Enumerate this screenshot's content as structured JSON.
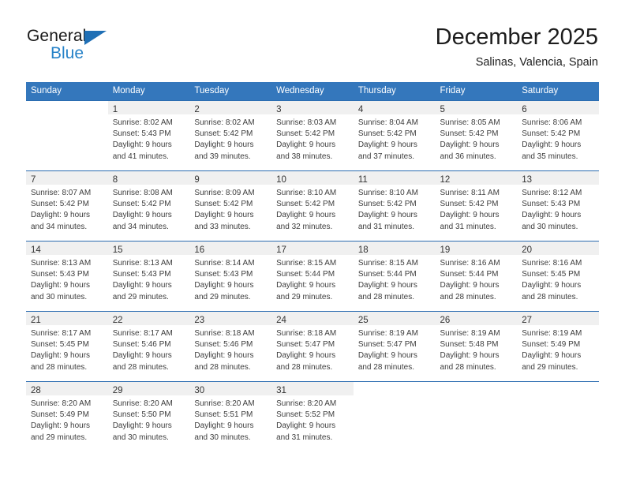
{
  "brand": {
    "name_part1": "General",
    "name_part2": "Blue",
    "accent_color": "#2682c8",
    "triangle_color": "#1f6fb5"
  },
  "header": {
    "title": "December 2025",
    "subtitle": "Salinas, Valencia, Spain"
  },
  "calendar": {
    "header_bg": "#3477bc",
    "separator_color": "#2b6cb0",
    "daynum_band_bg": "#f0f0f0",
    "weekdays": [
      "Sunday",
      "Monday",
      "Tuesday",
      "Wednesday",
      "Thursday",
      "Friday",
      "Saturday"
    ],
    "weeks": [
      [
        {
          "day": "",
          "sunrise": "",
          "sunset": "",
          "daylight1": "",
          "daylight2": ""
        },
        {
          "day": "1",
          "sunrise": "Sunrise: 8:02 AM",
          "sunset": "Sunset: 5:43 PM",
          "daylight1": "Daylight: 9 hours",
          "daylight2": "and 41 minutes."
        },
        {
          "day": "2",
          "sunrise": "Sunrise: 8:02 AM",
          "sunset": "Sunset: 5:42 PM",
          "daylight1": "Daylight: 9 hours",
          "daylight2": "and 39 minutes."
        },
        {
          "day": "3",
          "sunrise": "Sunrise: 8:03 AM",
          "sunset": "Sunset: 5:42 PM",
          "daylight1": "Daylight: 9 hours",
          "daylight2": "and 38 minutes."
        },
        {
          "day": "4",
          "sunrise": "Sunrise: 8:04 AM",
          "sunset": "Sunset: 5:42 PM",
          "daylight1": "Daylight: 9 hours",
          "daylight2": "and 37 minutes."
        },
        {
          "day": "5",
          "sunrise": "Sunrise: 8:05 AM",
          "sunset": "Sunset: 5:42 PM",
          "daylight1": "Daylight: 9 hours",
          "daylight2": "and 36 minutes."
        },
        {
          "day": "6",
          "sunrise": "Sunrise: 8:06 AM",
          "sunset": "Sunset: 5:42 PM",
          "daylight1": "Daylight: 9 hours",
          "daylight2": "and 35 minutes."
        }
      ],
      [
        {
          "day": "7",
          "sunrise": "Sunrise: 8:07 AM",
          "sunset": "Sunset: 5:42 PM",
          "daylight1": "Daylight: 9 hours",
          "daylight2": "and 34 minutes."
        },
        {
          "day": "8",
          "sunrise": "Sunrise: 8:08 AM",
          "sunset": "Sunset: 5:42 PM",
          "daylight1": "Daylight: 9 hours",
          "daylight2": "and 34 minutes."
        },
        {
          "day": "9",
          "sunrise": "Sunrise: 8:09 AM",
          "sunset": "Sunset: 5:42 PM",
          "daylight1": "Daylight: 9 hours",
          "daylight2": "and 33 minutes."
        },
        {
          "day": "10",
          "sunrise": "Sunrise: 8:10 AM",
          "sunset": "Sunset: 5:42 PM",
          "daylight1": "Daylight: 9 hours",
          "daylight2": "and 32 minutes."
        },
        {
          "day": "11",
          "sunrise": "Sunrise: 8:10 AM",
          "sunset": "Sunset: 5:42 PM",
          "daylight1": "Daylight: 9 hours",
          "daylight2": "and 31 minutes."
        },
        {
          "day": "12",
          "sunrise": "Sunrise: 8:11 AM",
          "sunset": "Sunset: 5:42 PM",
          "daylight1": "Daylight: 9 hours",
          "daylight2": "and 31 minutes."
        },
        {
          "day": "13",
          "sunrise": "Sunrise: 8:12 AM",
          "sunset": "Sunset: 5:43 PM",
          "daylight1": "Daylight: 9 hours",
          "daylight2": "and 30 minutes."
        }
      ],
      [
        {
          "day": "14",
          "sunrise": "Sunrise: 8:13 AM",
          "sunset": "Sunset: 5:43 PM",
          "daylight1": "Daylight: 9 hours",
          "daylight2": "and 30 minutes."
        },
        {
          "day": "15",
          "sunrise": "Sunrise: 8:13 AM",
          "sunset": "Sunset: 5:43 PM",
          "daylight1": "Daylight: 9 hours",
          "daylight2": "and 29 minutes."
        },
        {
          "day": "16",
          "sunrise": "Sunrise: 8:14 AM",
          "sunset": "Sunset: 5:43 PM",
          "daylight1": "Daylight: 9 hours",
          "daylight2": "and 29 minutes."
        },
        {
          "day": "17",
          "sunrise": "Sunrise: 8:15 AM",
          "sunset": "Sunset: 5:44 PM",
          "daylight1": "Daylight: 9 hours",
          "daylight2": "and 29 minutes."
        },
        {
          "day": "18",
          "sunrise": "Sunrise: 8:15 AM",
          "sunset": "Sunset: 5:44 PM",
          "daylight1": "Daylight: 9 hours",
          "daylight2": "and 28 minutes."
        },
        {
          "day": "19",
          "sunrise": "Sunrise: 8:16 AM",
          "sunset": "Sunset: 5:44 PM",
          "daylight1": "Daylight: 9 hours",
          "daylight2": "and 28 minutes."
        },
        {
          "day": "20",
          "sunrise": "Sunrise: 8:16 AM",
          "sunset": "Sunset: 5:45 PM",
          "daylight1": "Daylight: 9 hours",
          "daylight2": "and 28 minutes."
        }
      ],
      [
        {
          "day": "21",
          "sunrise": "Sunrise: 8:17 AM",
          "sunset": "Sunset: 5:45 PM",
          "daylight1": "Daylight: 9 hours",
          "daylight2": "and 28 minutes."
        },
        {
          "day": "22",
          "sunrise": "Sunrise: 8:17 AM",
          "sunset": "Sunset: 5:46 PM",
          "daylight1": "Daylight: 9 hours",
          "daylight2": "and 28 minutes."
        },
        {
          "day": "23",
          "sunrise": "Sunrise: 8:18 AM",
          "sunset": "Sunset: 5:46 PM",
          "daylight1": "Daylight: 9 hours",
          "daylight2": "and 28 minutes."
        },
        {
          "day": "24",
          "sunrise": "Sunrise: 8:18 AM",
          "sunset": "Sunset: 5:47 PM",
          "daylight1": "Daylight: 9 hours",
          "daylight2": "and 28 minutes."
        },
        {
          "day": "25",
          "sunrise": "Sunrise: 8:19 AM",
          "sunset": "Sunset: 5:47 PM",
          "daylight1": "Daylight: 9 hours",
          "daylight2": "and 28 minutes."
        },
        {
          "day": "26",
          "sunrise": "Sunrise: 8:19 AM",
          "sunset": "Sunset: 5:48 PM",
          "daylight1": "Daylight: 9 hours",
          "daylight2": "and 28 minutes."
        },
        {
          "day": "27",
          "sunrise": "Sunrise: 8:19 AM",
          "sunset": "Sunset: 5:49 PM",
          "daylight1": "Daylight: 9 hours",
          "daylight2": "and 29 minutes."
        }
      ],
      [
        {
          "day": "28",
          "sunrise": "Sunrise: 8:20 AM",
          "sunset": "Sunset: 5:49 PM",
          "daylight1": "Daylight: 9 hours",
          "daylight2": "and 29 minutes."
        },
        {
          "day": "29",
          "sunrise": "Sunrise: 8:20 AM",
          "sunset": "Sunset: 5:50 PM",
          "daylight1": "Daylight: 9 hours",
          "daylight2": "and 30 minutes."
        },
        {
          "day": "30",
          "sunrise": "Sunrise: 8:20 AM",
          "sunset": "Sunset: 5:51 PM",
          "daylight1": "Daylight: 9 hours",
          "daylight2": "and 30 minutes."
        },
        {
          "day": "31",
          "sunrise": "Sunrise: 8:20 AM",
          "sunset": "Sunset: 5:52 PM",
          "daylight1": "Daylight: 9 hours",
          "daylight2": "and 31 minutes."
        },
        {
          "day": "",
          "sunrise": "",
          "sunset": "",
          "daylight1": "",
          "daylight2": ""
        },
        {
          "day": "",
          "sunrise": "",
          "sunset": "",
          "daylight1": "",
          "daylight2": ""
        },
        {
          "day": "",
          "sunrise": "",
          "sunset": "",
          "daylight1": "",
          "daylight2": ""
        }
      ]
    ]
  }
}
